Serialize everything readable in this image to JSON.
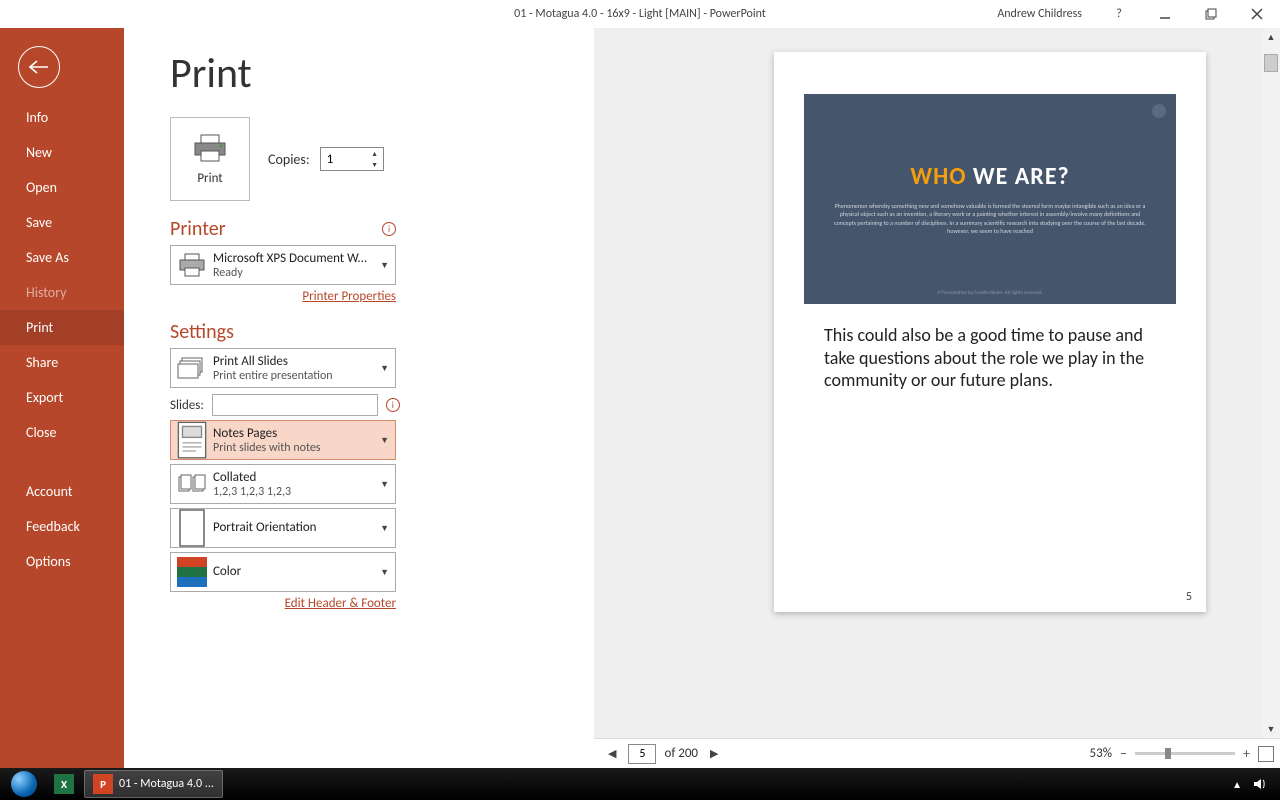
{
  "titlebar": {
    "title": "01 - Motagua 4.0 - 16x9 - Light [MAIN]  -  PowerPoint",
    "user": "Andrew Childress"
  },
  "sidebar": {
    "items": [
      {
        "label": "Info",
        "key": "info"
      },
      {
        "label": "New",
        "key": "new"
      },
      {
        "label": "Open",
        "key": "open"
      },
      {
        "label": "Save",
        "key": "save"
      },
      {
        "label": "Save As",
        "key": "saveas"
      },
      {
        "label": "History",
        "key": "history",
        "dim": true
      },
      {
        "label": "Print",
        "key": "print",
        "active": true
      },
      {
        "label": "Share",
        "key": "share"
      },
      {
        "label": "Export",
        "key": "export"
      },
      {
        "label": "Close",
        "key": "close"
      }
    ],
    "footer_items": [
      {
        "label": "Account",
        "key": "account"
      },
      {
        "label": "Feedback",
        "key": "feedback"
      },
      {
        "label": "Options",
        "key": "options"
      }
    ]
  },
  "page": {
    "title": "Print",
    "print_btn_label": "Print",
    "copies_label": "Copies:",
    "copies_value": "1"
  },
  "printer": {
    "heading": "Printer",
    "name": "Microsoft XPS Document W...",
    "status": "Ready",
    "properties_link": "Printer Properties"
  },
  "settings": {
    "heading": "Settings",
    "slides_label": "Slides:",
    "slides_value": "",
    "print_what_title": "Print All Slides",
    "print_what_sub": "Print entire presentation",
    "layout_title": "Notes Pages",
    "layout_sub": "Print slides with notes",
    "collate_title": "Collated",
    "collate_sub": "1,2,3    1,2,3    1,2,3",
    "orientation": "Portrait Orientation",
    "color": "Color",
    "edit_hf": "Edit Header & Footer"
  },
  "preview": {
    "slide_title_who": "WHO",
    "slide_title_rest": " WE ARE?",
    "slide_body": "Phenomenon whereby something new and somehow valuable is formed the steered form maybe intangible such as an idea or a physical object such as an invention, a literary work or a painting whether interest in assembly/involve many definitions and concepts pertaining to a number of disciplines. In a summary scientific research into studying over the course of the last decade, however, we seem to have reached",
    "slide_foot": "A Presentation by CreativeSlides. All rights reserved.",
    "notes": "This could also be a good time to pause and take questions about the role we play in the community or our future plans.",
    "page_number": "5"
  },
  "pager": {
    "current": "5",
    "of_label": "of 200"
  },
  "zoom": {
    "percent": "53%"
  },
  "taskbar": {
    "app_label": "01 - Motagua 4.0 ..."
  },
  "colors": {
    "swatch": [
      "#d04423",
      "#1f7244",
      "#1f6fbf"
    ]
  }
}
